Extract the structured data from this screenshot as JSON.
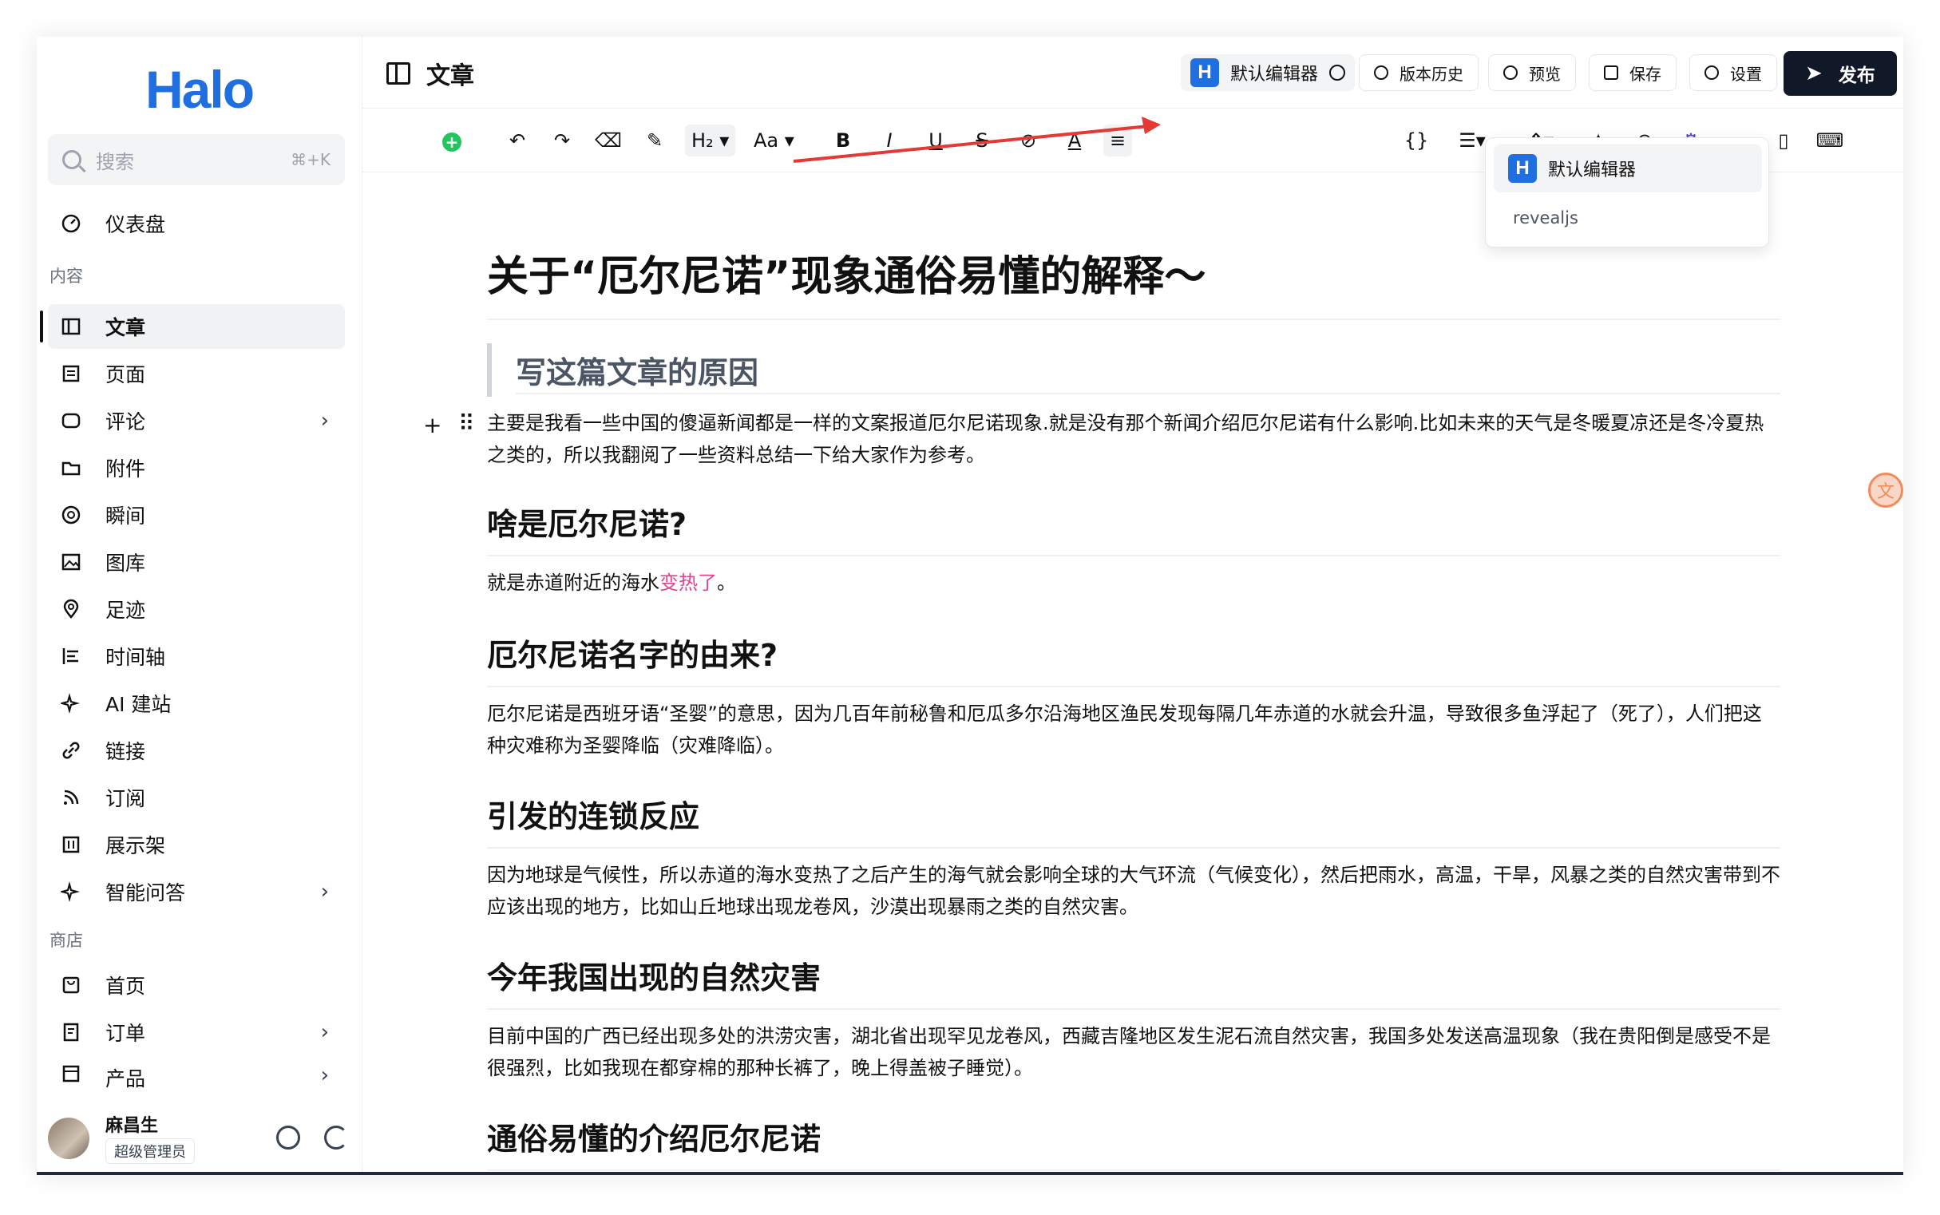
{
  "app": {
    "logo": "Halo"
  },
  "search": {
    "placeholder": "搜索",
    "shortcut": "⌘+K"
  },
  "sidebar": {
    "dashboard": "仪表盘",
    "section_content": "内容",
    "items": [
      {
        "label": "文章",
        "icon": "article-icon"
      },
      {
        "label": "页面",
        "icon": "page-icon"
      },
      {
        "label": "评论",
        "icon": "comment-icon"
      },
      {
        "label": "附件",
        "icon": "folder-icon"
      },
      {
        "label": "瞬间",
        "icon": "aperture-icon"
      },
      {
        "label": "图库",
        "icon": "image-icon"
      },
      {
        "label": "足迹",
        "icon": "location-icon"
      },
      {
        "label": "时间轴",
        "icon": "timeline-icon"
      },
      {
        "label": "AI 建站",
        "icon": "sparkle-icon"
      },
      {
        "label": "链接",
        "icon": "link-icon"
      },
      {
        "label": "订阅",
        "icon": "rss-icon"
      },
      {
        "label": "展示架",
        "icon": "shelf-icon"
      },
      {
        "label": "智能问答",
        "icon": "sparkle-icon"
      }
    ],
    "section_store": "商店",
    "store_items": [
      {
        "label": "首页",
        "icon": "store-home-icon"
      },
      {
        "label": "订单",
        "icon": "order-icon"
      },
      {
        "label": "产品",
        "icon": "product-icon"
      }
    ]
  },
  "user": {
    "name": "麻昌生",
    "role": "超级管理员"
  },
  "header": {
    "title": "文章",
    "editor_label": "默认编辑器",
    "history": "版本历史",
    "preview": "预览",
    "save": "保存",
    "settings": "设置",
    "publish": "发布"
  },
  "toolbar": {
    "heading": "H₂",
    "font": "Aa",
    "bold": "B",
    "italic": "I",
    "underline": "U",
    "strike": "S"
  },
  "dropdown": {
    "selected": "默认编辑器",
    "other": "revealjs"
  },
  "colors": {
    "accent": "#1f6fe0",
    "pink_text": "#e0448f",
    "publish_bg": "#111827",
    "annotation_arrow": "#e53935"
  },
  "article": {
    "title": "关于“厄尔尼诺”现象通俗易懂的解释～",
    "quote": "写这篇文章的原因",
    "intro": "主要是我看一些中国的傻逼新闻都是一样的文案报道厄尔尼诺现象.就是没有那个新闻介绍厄尔尼诺有什么影响.比如未来的天气是冬暖夏凉还是冬冷夏热之类的，所以我翻阅了一些资料总结一下给大家作为参考。",
    "h_what": "啥是厄尔尼诺?",
    "p_what_a": "就是赤道附近的海水",
    "p_what_b": "变热了",
    "p_what_c": "。",
    "h_name": "厄尔尼诺名字的由来?",
    "p_name": "厄尔尼诺是西班牙语“圣婴”的意思，因为几百年前秘鲁和厄瓜多尔沿海地区渔民发现每隔几年赤道的水就会升温，导致很多鱼浮起了（死了），人们把这种灾难称为圣婴降临（灾难降临）。",
    "h_chain": "引发的连锁反应",
    "p_chain": "因为地球是气候性，所以赤道的海水变热了之后产生的海气就会影响全球的大气环流（气候变化），然后把雨水，高温，干旱，风暴之类的自然灾害带到不应该出现的地方，比如山丘地球出现龙卷风，沙漠出现暴雨之类的自然灾害。",
    "h_disaster": "今年我国出现的自然灾害",
    "p_disaster": "目前中国的广西已经出现多处的洪涝灾害，湖北省出现罕见龙卷风，西藏吉隆地区发生泥石流自然灾害，我国多处发送高温现象（我在贵阳倒是感受不是很强烈，比如我现在都穿棉的那种长裤了，晚上得盖被子睡觉）。",
    "h_intro": "通俗易懂的介绍厄尔尼诺"
  }
}
